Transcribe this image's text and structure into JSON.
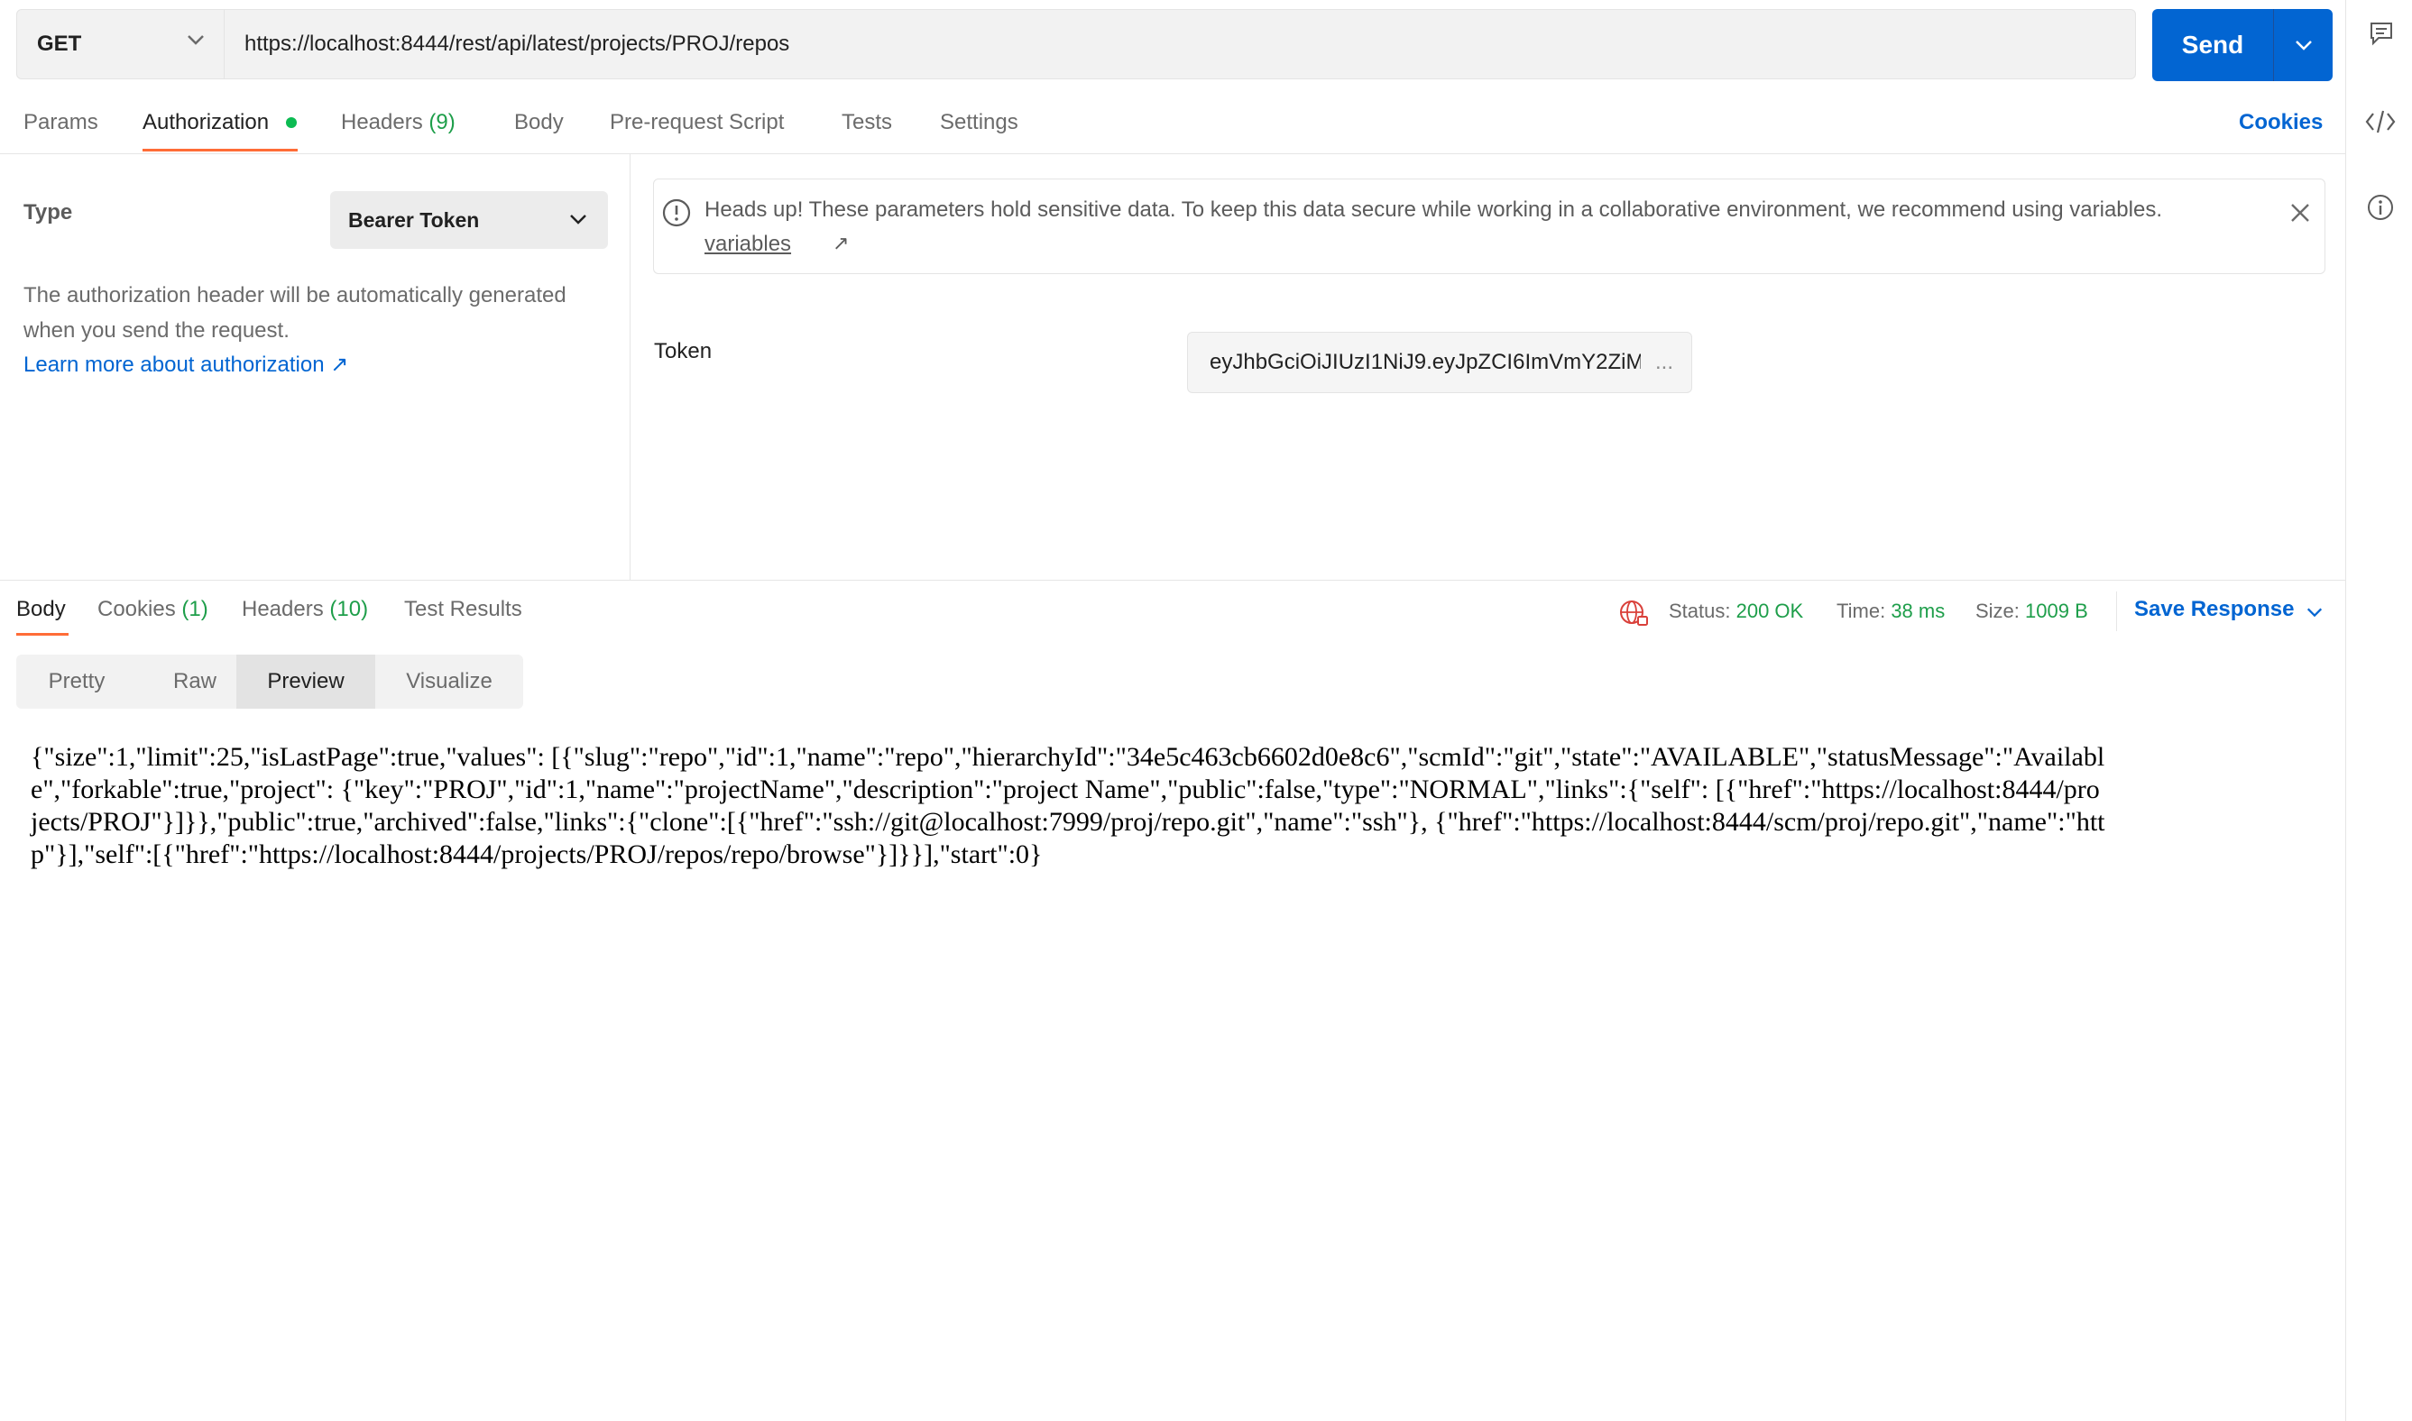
{
  "request": {
    "method": "GET",
    "url": "https://localhost:8444/rest/api/latest/projects/PROJ/repos",
    "send_label": "Send"
  },
  "request_tabs": {
    "params": "Params",
    "authorization": "Authorization",
    "headers": "Headers",
    "headers_count": "(9)",
    "body": "Body",
    "prerequest": "Pre-request Script",
    "tests": "Tests",
    "settings": "Settings",
    "cookies": "Cookies"
  },
  "auth": {
    "type_label": "Type",
    "type_value": "Bearer Token",
    "description": "The authorization header will be automatically generated when you send the request.",
    "learn_more": "Learn more about authorization ↗",
    "banner_text": "Heads up! These parameters hold sensitive data. To keep this data secure while working in a collaborative environment, we recommend using variables.",
    "banner_link": "variables",
    "token_label": "Token",
    "token_value": "eyJhbGciOiJIUzI1NiJ9.eyJpZCI6ImVmY2ZiM",
    "token_ellipsis": "..."
  },
  "response_tabs": {
    "body": "Body",
    "cookies": "Cookies",
    "cookies_count": "(1)",
    "headers": "Headers",
    "headers_count": "(10)",
    "test_results": "Test Results"
  },
  "response_status": {
    "status_label": "Status:",
    "status_value": "200 OK",
    "time_label": "Time:",
    "time_value": "38 ms",
    "size_label": "Size:",
    "size_value": "1009 B",
    "save_response": "Save Response"
  },
  "format_toggle": {
    "pretty": "Pretty",
    "raw": "Raw",
    "preview": "Preview",
    "visualize": "Visualize",
    "selected": "Preview"
  },
  "preview_body": "{\"size\":1,\"limit\":25,\"isLastPage\":true,\"values\": [{\"slug\":\"repo\",\"id\":1,\"name\":\"repo\",\"hierarchyId\":\"34e5c463cb6602d0e8c6\",\"scmId\":\"git\",\"state\":\"AVAILABLE\",\"statusMessage\":\"Available\",\"forkable\":true,\"project\": {\"key\":\"PROJ\",\"id\":1,\"name\":\"projectName\",\"description\":\"project Name\",\"public\":false,\"type\":\"NORMAL\",\"links\":{\"self\": [{\"href\":\"https://localhost:8444/projects/PROJ\"}]}},\"public\":true,\"archived\":false,\"links\":{\"clone\":[{\"href\":\"ssh://git@localhost:7999/proj/repo.git\",\"name\":\"ssh\"}, {\"href\":\"https://localhost:8444/scm/proj/repo.git\",\"name\":\"http\"}],\"self\":[{\"href\":\"https://localhost:8444/projects/PROJ/repos/repo/browse\"}]}}],\"start\":0}",
  "icons": {
    "comments": "comment-icon",
    "code": "code-icon",
    "info": "info-icon",
    "globe": "globe-icon"
  },
  "colors": {
    "accent": "#ff6c37",
    "primary": "#0265d2",
    "success": "#1e9e4a",
    "globe": "#d9403a"
  }
}
